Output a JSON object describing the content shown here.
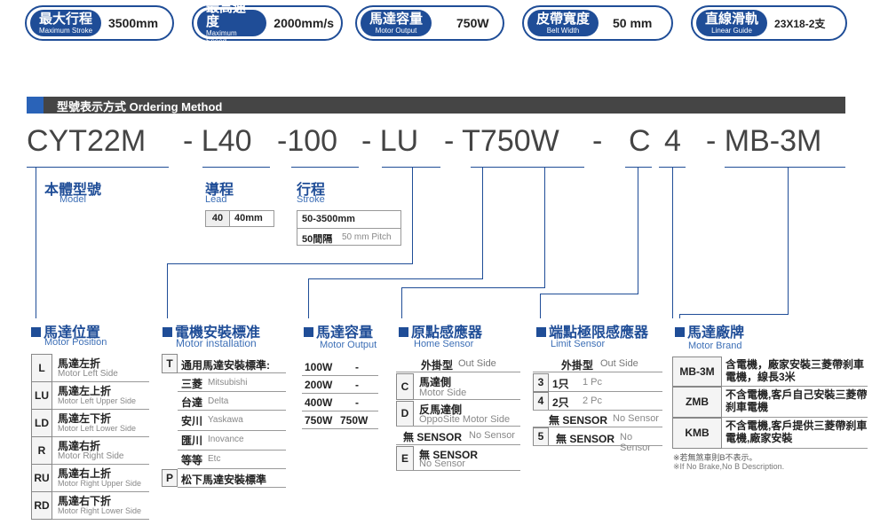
{
  "specs": [
    {
      "cn": "最大行程",
      "en": "Maximum Stroke",
      "value": "3500mm"
    },
    {
      "cn": "最高速度",
      "en": "Maximum Speed",
      "value": "2000mm/s"
    },
    {
      "cn": "馬達容量",
      "en": "Motor Output",
      "value": "750W"
    },
    {
      "cn": "皮帶寬度",
      "en": "Belt Width",
      "value": "50 mm"
    },
    {
      "cn": "直線滑軌",
      "en": "Linear Guide",
      "value": "23X18-2支"
    }
  ],
  "section_title": "型號表示方式 Ordering Method",
  "code": {
    "p1": "CYT22M",
    "p2": "- L40",
    "p3": "-100",
    "p4": "- LU",
    "p5": "- T750W",
    "p6": "-",
    "p7": "C",
    "p8": "4",
    "p9": "- MB-3M"
  },
  "model": {
    "cn": "本體型號",
    "en": "Model"
  },
  "lead": {
    "cn": "導程",
    "en": "Lead",
    "code": "40",
    "value": "40mm"
  },
  "stroke": {
    "cn": "行程",
    "en": "Stroke",
    "range": "50-3500mm",
    "pitch_cn": "50間隔",
    "pitch_en": "50 mm Pitch"
  },
  "motor_position": {
    "cn": "馬達位置",
    "en": "Motor Position",
    "rows": [
      {
        "code": "L",
        "cn": "馬達左折",
        "en": "Motor Left Side"
      },
      {
        "code": "LU",
        "cn": "馬達左上折",
        "en": "Motor Left Upper Side"
      },
      {
        "code": "LD",
        "cn": "馬達左下折",
        "en": "Motor Left Lower Side"
      },
      {
        "code": "R",
        "cn": "馬達右折",
        "en": "Motor Right Side"
      },
      {
        "code": "RU",
        "cn": "馬達右上折",
        "en": "Motor Right Upper Side"
      },
      {
        "code": "RD",
        "cn": "馬達右下折",
        "en": "Motor Right Lower Side"
      }
    ]
  },
  "motor_install": {
    "cn": "電機安裝標准",
    "en": "Motor installation",
    "rows": [
      {
        "code": "T",
        "cn": "通用馬達安裝標準:",
        "en": ""
      },
      {
        "code": "",
        "cn": "三菱",
        "en": "Mitsubishi"
      },
      {
        "code": "",
        "cn": "台達",
        "en": "Delta"
      },
      {
        "code": "",
        "cn": "安川",
        "en": "Yaskawa"
      },
      {
        "code": "",
        "cn": "匯川",
        "en": "Inovance"
      },
      {
        "code": "",
        "cn": "等等",
        "en": "Etc"
      },
      {
        "code": "P",
        "cn": "松下馬達安裝標準",
        "en": ""
      }
    ]
  },
  "motor_output": {
    "cn": "馬達容量",
    "en": "Motor Output",
    "rows": [
      {
        "a": "100W",
        "b": "-"
      },
      {
        "a": "200W",
        "b": "-"
      },
      {
        "a": "400W",
        "b": "-"
      },
      {
        "a": "750W",
        "b": "750W"
      }
    ]
  },
  "home_sensor": {
    "cn": "原點感應器",
    "en": "Home Sensor",
    "header_cn": "外掛型",
    "header_en": "Out Side",
    "rows": [
      {
        "code": "C",
        "cn": "馬達側",
        "en": "Motor Side"
      },
      {
        "code": "D",
        "cn": "反馬達側",
        "en": "OppoSite Motor Side"
      },
      {
        "code": "",
        "cn": "無 SENSOR",
        "en": "No Sensor"
      },
      {
        "code": "E",
        "cn": "無 SENSOR",
        "en": "No Sensor"
      }
    ]
  },
  "limit_sensor": {
    "cn": "端點極限感應器",
    "en": "Limit Sensor",
    "header_cn": "外掛型",
    "header_en": "Out Side",
    "rows": [
      {
        "code": "3",
        "cn": "1只",
        "en": "1 Pc"
      },
      {
        "code": "4",
        "cn": "2只",
        "en": "2 Pc"
      },
      {
        "code": "",
        "cn": "無 SENSOR",
        "en": "No Sensor"
      },
      {
        "code": "5",
        "cn": "無 SENSOR",
        "en": "No Sensor"
      }
    ]
  },
  "motor_brand": {
    "cn": "馬達廠牌",
    "en": "Motor Brand",
    "rows": [
      {
        "code": "MB-3M",
        "desc": "含電機，廠家安裝三菱帶刹車電機，線長3米"
      },
      {
        "code": "ZMB",
        "desc": "不含電機,客戶自己安裝三菱帶刹車電機"
      },
      {
        "code": "KMB",
        "desc": "不含電機,客戶提供三菱帶刹車電機,廠家安裝"
      }
    ],
    "note_cn": "※若無煞車則B不表示。",
    "note_en": "※If No Brake,No B Description."
  }
}
